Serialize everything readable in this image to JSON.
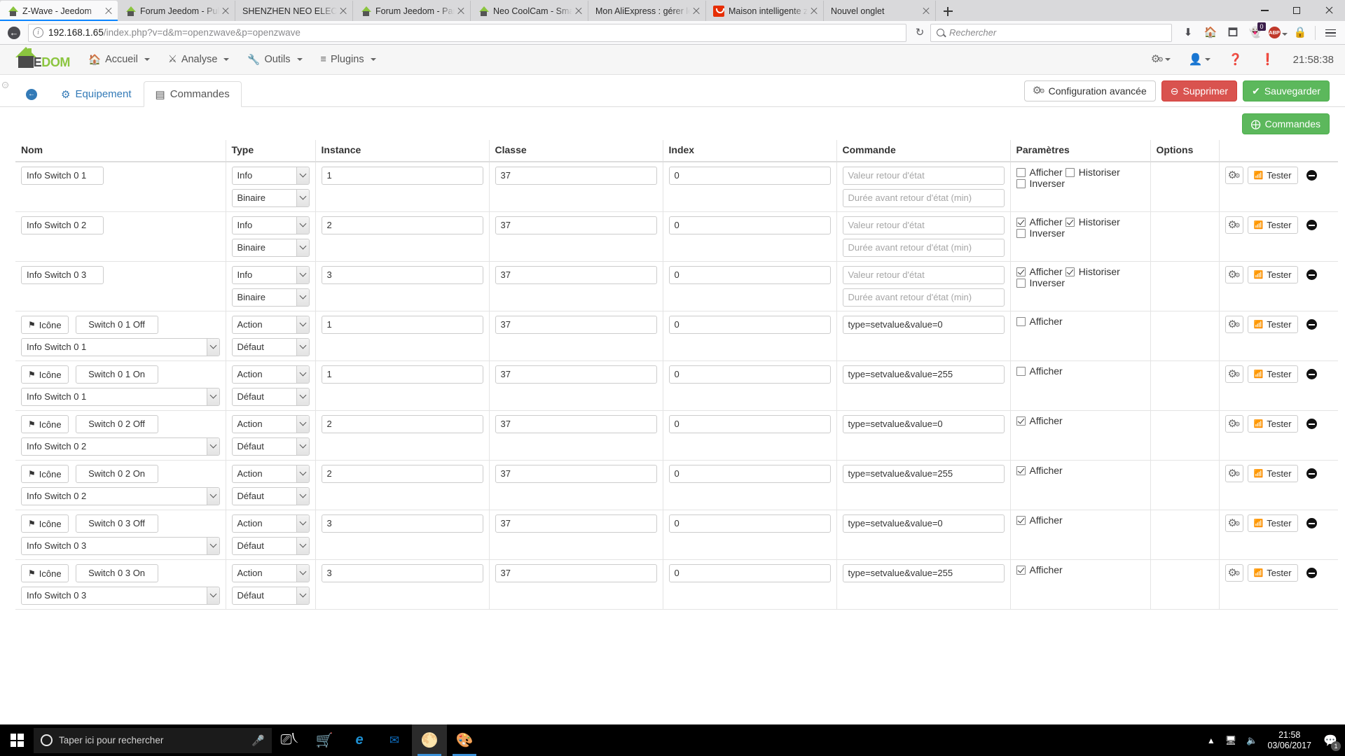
{
  "browser": {
    "tabs": [
      {
        "title": "Z-Wave - Jeedom",
        "favicon": "jeedom-icon",
        "active": true
      },
      {
        "title": "Forum Jeedom - Publier un",
        "favicon": "jeedom-icon",
        "active": false
      },
      {
        "title": "SHENZHEN NEO ELECTRONICS",
        "favicon": "none",
        "active": false
      },
      {
        "title": "Forum Jeedom - Panneau d",
        "favicon": "jeedom-icon",
        "active": false
      },
      {
        "title": "Neo CoolCam - Smart Powe",
        "favicon": "jeedom-icon",
        "active": false
      },
      {
        "title": "Mon AliExpress : gérer les comm",
        "favicon": "none",
        "active": false
      },
      {
        "title": "Maison intelligente z wave N",
        "favicon": "aliexpress-icon",
        "active": false
      },
      {
        "title": "Nouvel onglet",
        "favicon": "none",
        "active": false
      }
    ],
    "url_host": "192.168.1.65",
    "url_path": "/index.php?v=d&m=openzwave&p=openzwave",
    "search_placeholder": "Rechercher",
    "ghostery_badge": "0",
    "abp_label": "ABP"
  },
  "jeedom": {
    "logo_dark": "J",
    "logo_text_a": "EE",
    "logo_text_b": "DOM",
    "menu": [
      {
        "label": "Accueil",
        "icon": "home-icon"
      },
      {
        "label": "Analyse",
        "icon": "stethoscope-icon"
      },
      {
        "label": "Outils",
        "icon": "wrench-icon"
      },
      {
        "label": "Plugins",
        "icon": "list-icon"
      }
    ],
    "clock": "21:58:38"
  },
  "panel": {
    "tabs": [
      {
        "label": "Equipement",
        "icon": "dashboard-icon",
        "active": false
      },
      {
        "label": "Commandes",
        "icon": "table-icon",
        "active": true
      }
    ],
    "back_icon": "back-arrow-icon",
    "buttons": {
      "advanced": "Configuration avancée",
      "delete": "Supprimer",
      "save": "Sauvegarder",
      "add_command": "Commandes"
    }
  },
  "table": {
    "headers": [
      "Nom",
      "Type",
      "Instance",
      "Classe",
      "Index",
      "Commande",
      "Paramètres",
      "Options",
      ""
    ],
    "placeholders": {
      "valeur_retour": "Valeur retour d'état",
      "duree_retour": "Durée avant retour d'état (min)"
    },
    "labels": {
      "afficher": "Afficher",
      "historiser": "Historiser",
      "inverser": "Inverser",
      "icone": "Icône",
      "tester": "Tester"
    },
    "rows": [
      {
        "kind": "info",
        "nom": "Info Switch 0 1",
        "type": "Info",
        "subtype": "Binaire",
        "instance": "1",
        "classe": "37",
        "index": "0",
        "commande": "",
        "afficher": false,
        "historiser": false,
        "inverser": false
      },
      {
        "kind": "info",
        "nom": "Info Switch 0 2",
        "type": "Info",
        "subtype": "Binaire",
        "instance": "2",
        "classe": "37",
        "index": "0",
        "commande": "",
        "afficher": true,
        "historiser": true,
        "inverser": false
      },
      {
        "kind": "info",
        "nom": "Info Switch 0 3",
        "type": "Info",
        "subtype": "Binaire",
        "instance": "3",
        "classe": "37",
        "index": "0",
        "commande": "",
        "afficher": true,
        "historiser": true,
        "inverser": false
      },
      {
        "kind": "action",
        "nom": "Switch 0 1 Off",
        "linked_info": "Info Switch 0 1",
        "type": "Action",
        "subtype": "Défaut",
        "instance": "1",
        "classe": "37",
        "index": "0",
        "commande": "type=setvalue&value=0",
        "afficher": false
      },
      {
        "kind": "action",
        "nom": "Switch 0 1 On",
        "linked_info": "Info Switch 0 1",
        "type": "Action",
        "subtype": "Défaut",
        "instance": "1",
        "classe": "37",
        "index": "0",
        "commande": "type=setvalue&value=255",
        "afficher": false
      },
      {
        "kind": "action",
        "nom": "Switch 0 2 Off",
        "linked_info": "Info Switch 0 2",
        "type": "Action",
        "subtype": "Défaut",
        "instance": "2",
        "classe": "37",
        "index": "0",
        "commande": "type=setvalue&value=0",
        "afficher": true
      },
      {
        "kind": "action",
        "nom": "Switch 0 2 On",
        "linked_info": "Info Switch 0 2",
        "type": "Action",
        "subtype": "Défaut",
        "instance": "2",
        "classe": "37",
        "index": "0",
        "commande": "type=setvalue&value=255",
        "afficher": true
      },
      {
        "kind": "action",
        "nom": "Switch 0 3 Off",
        "linked_info": "Info Switch 0 3",
        "type": "Action",
        "subtype": "Défaut",
        "instance": "3",
        "classe": "37",
        "index": "0",
        "commande": "type=setvalue&value=0",
        "afficher": true
      },
      {
        "kind": "action",
        "nom": "Switch 0 3 On",
        "linked_info": "Info Switch 0 3",
        "type": "Action",
        "subtype": "Défaut",
        "instance": "3",
        "classe": "37",
        "index": "0",
        "commande": "type=setvalue&value=255",
        "afficher": true
      }
    ]
  },
  "taskbar": {
    "search_placeholder": "Taper ici pour rechercher",
    "time": "21:58",
    "date": "03/06/2017",
    "notification_count": "1"
  },
  "colors": {
    "accent_blue": "#337ab7",
    "danger": "#d9534f",
    "success": "#5cb85c",
    "jeedom_green": "#8bc53f"
  }
}
